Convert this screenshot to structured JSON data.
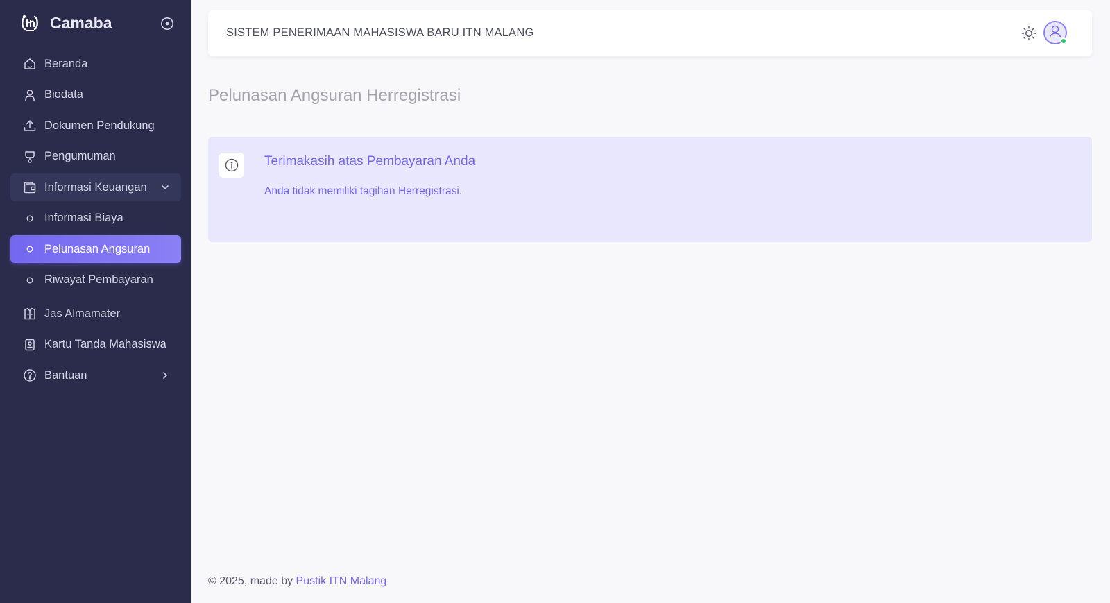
{
  "brand": {
    "name": "Camaba",
    "logo_icon": "itn-logo-icon",
    "toggle_icon": "sidebar-toggle-circle-icon"
  },
  "sidebar": {
    "items": [
      {
        "label": "Beranda",
        "icon": "home-icon"
      },
      {
        "label": "Biodata",
        "icon": "user-icon"
      },
      {
        "label": "Dokumen Pendukung",
        "icon": "upload-icon"
      },
      {
        "label": "Pengumuman",
        "icon": "announcement-icon"
      },
      {
        "label": "Informasi Keuangan",
        "icon": "wallet-icon",
        "expanded": true
      },
      {
        "label": "Informasi Biaya",
        "icon": "circle-icon"
      },
      {
        "label": "Pelunasan Angsuran",
        "icon": "circle-icon",
        "active": true
      },
      {
        "label": "Riwayat Pembayaran",
        "icon": "circle-icon"
      },
      {
        "label": "Jas Almamater",
        "icon": "jacket-icon"
      },
      {
        "label": "Kartu Tanda Mahasiswa",
        "icon": "id-card-icon"
      },
      {
        "label": "Bantuan",
        "icon": "help-icon"
      }
    ]
  },
  "header": {
    "title": "SISTEM PENERIMAAN MAHASISWA BARU ITN MALANG",
    "theme_icon": "sun-icon",
    "avatar_icon": "user-avatar-icon",
    "status": "online"
  },
  "main": {
    "page_title": "Pelunasan Angsuran Herregistrasi",
    "alert": {
      "heading": "Terimakasih atas Pembayaran Anda",
      "text": "Anda tidak memiliki tagihan Herregistrasi.",
      "icon": "info-icon"
    }
  },
  "footer": {
    "text": "© 2025, made by",
    "link": "Pustik ITN Malang"
  },
  "colors": {
    "primary": "#7367f0",
    "sidebar_bg": "#2b2c4c",
    "alert_bg": "#e9e7fd",
    "online": "#28c76f"
  }
}
